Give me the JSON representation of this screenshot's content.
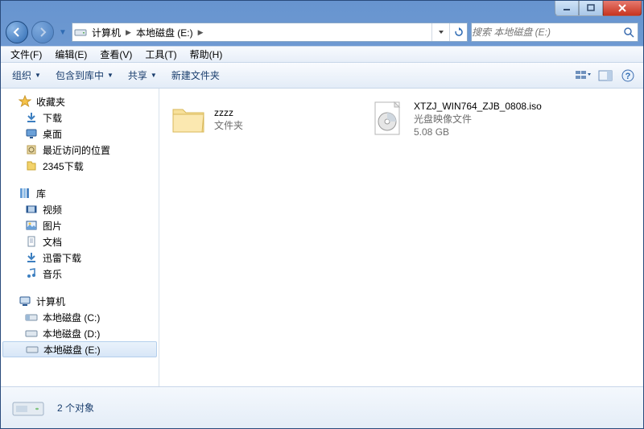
{
  "titlebar": {},
  "nav": {
    "breadcrumbs": [
      "计算机",
      "本地磁盘 (E:)"
    ],
    "search_placeholder": "搜索 本地磁盘 (E:)"
  },
  "menubar": {
    "items": [
      {
        "label": "文件(F)"
      },
      {
        "label": "编辑(E)"
      },
      {
        "label": "查看(V)"
      },
      {
        "label": "工具(T)"
      },
      {
        "label": "帮助(H)"
      }
    ]
  },
  "toolbar": {
    "organize": "组织",
    "include": "包含到库中",
    "share": "共享",
    "newfolder": "新建文件夹"
  },
  "sidebar": {
    "groups": [
      {
        "head": "收藏夹",
        "head_icon": "star",
        "items": [
          {
            "icon": "download",
            "label": "下载"
          },
          {
            "icon": "desktop",
            "label": "桌面"
          },
          {
            "icon": "recent",
            "label": "最近访问的位置"
          },
          {
            "icon": "download",
            "label": "2345下载"
          }
        ]
      },
      {
        "head": "库",
        "head_icon": "library",
        "items": [
          {
            "icon": "video",
            "label": "视频"
          },
          {
            "icon": "picture",
            "label": "图片"
          },
          {
            "icon": "doc",
            "label": "文档"
          },
          {
            "icon": "download",
            "label": "迅雷下载"
          },
          {
            "icon": "music",
            "label": "音乐"
          }
        ]
      },
      {
        "head": "计算机",
        "head_icon": "computer",
        "items": [
          {
            "icon": "drive",
            "label": "本地磁盘 (C:)"
          },
          {
            "icon": "drive",
            "label": "本地磁盘 (D:)"
          },
          {
            "icon": "drive",
            "label": "本地磁盘 (E:)",
            "selected": true
          }
        ]
      }
    ]
  },
  "content": {
    "items": [
      {
        "kind": "folder",
        "name": "zzzz",
        "sub1": "文件夹",
        "sub2": ""
      },
      {
        "kind": "iso",
        "name": "XTZJ_WIN764_ZJB_0808.iso",
        "sub1": "光盘映像文件",
        "sub2": "5.08 GB"
      }
    ]
  },
  "details": {
    "text": "2 个对象"
  }
}
